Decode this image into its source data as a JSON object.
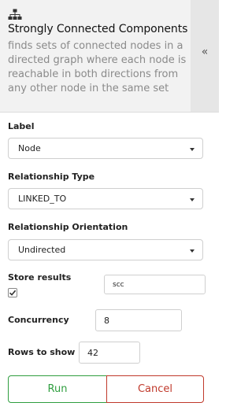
{
  "header": {
    "icon": "hierarchy-icon",
    "title": "Strongly Connected Components",
    "description": "finds sets of connected nodes in a directed graph where each node is reachable in both directions from any other node in the same set",
    "collapse_glyph": "«"
  },
  "form": {
    "label": {
      "caption": "Label",
      "value": "Node"
    },
    "relationship_type": {
      "caption": "Relationship Type",
      "value": "LINKED_TO"
    },
    "relationship_orientation": {
      "caption": "Relationship Orientation",
      "value": "Undirected"
    },
    "store_results": {
      "caption": "Store results",
      "checked": true,
      "property_value": "scc"
    },
    "concurrency": {
      "caption": "Concurrency",
      "value": "8"
    },
    "rows_to_show": {
      "caption": "Rows to show",
      "value": "42"
    }
  },
  "actions": {
    "run_label": "Run",
    "cancel_label": "Cancel"
  },
  "colors": {
    "run": "#2f9e3f",
    "cancel": "#c0392b",
    "header_bg": "#f2f2f2",
    "muted_text": "#8a8a8a"
  }
}
